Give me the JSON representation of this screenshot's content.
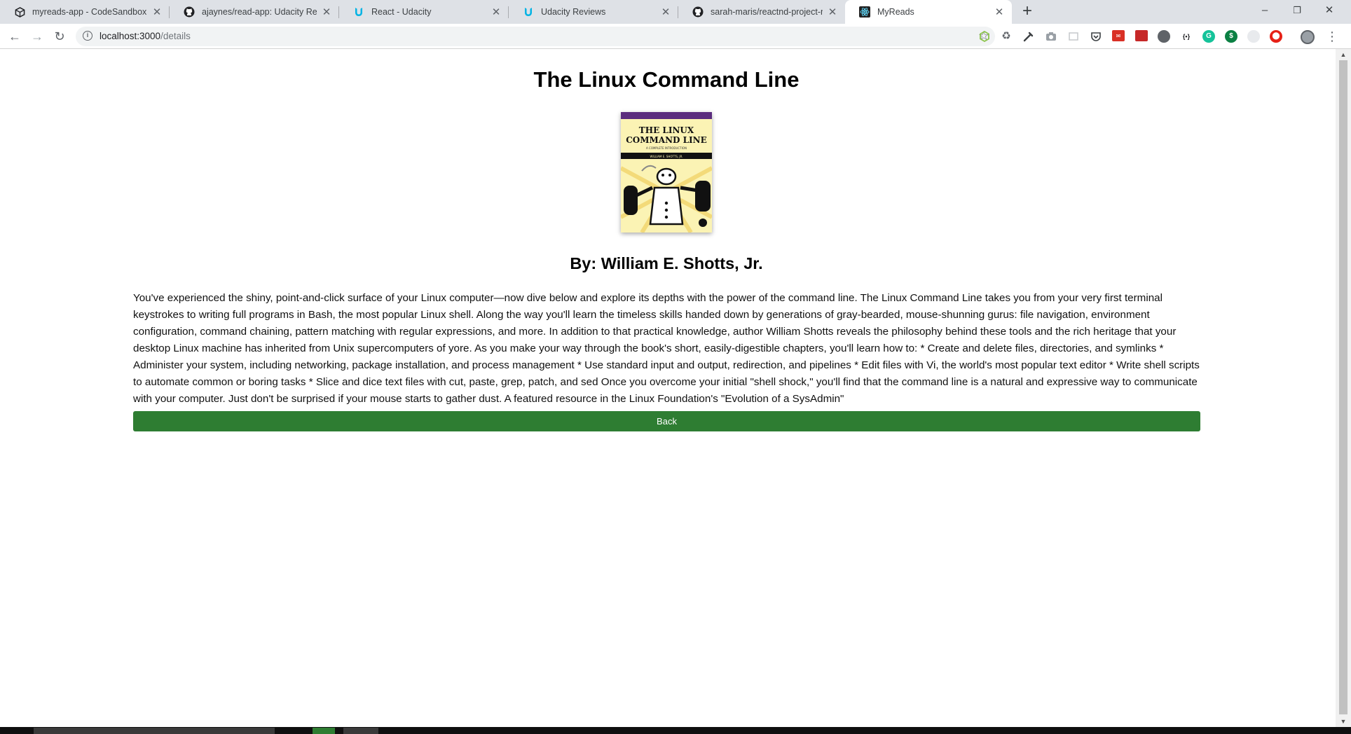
{
  "browser": {
    "tabs": [
      {
        "title": "myreads-app - CodeSandbox",
        "icon": "codesandbox-icon",
        "active": false
      },
      {
        "title": "ajaynes/read-app: Udacity Read",
        "icon": "github-icon",
        "active": false
      },
      {
        "title": "React - Udacity",
        "icon": "udacity-icon",
        "active": false
      },
      {
        "title": "Udacity Reviews",
        "icon": "udacity-icon",
        "active": false
      },
      {
        "title": "sarah-maris/reactnd-project-my",
        "icon": "github-icon",
        "active": false
      },
      {
        "title": "MyReads",
        "icon": "react-icon",
        "active": true
      }
    ],
    "new_tab_symbol": "+",
    "window_controls": {
      "minimize": "–",
      "restore": "❐",
      "close": "✕"
    },
    "address": {
      "host": "localhost:3000",
      "path": "/details"
    },
    "colors": {
      "tabstrip_bg": "#dee1e6",
      "omnibox_bg": "#f1f3f4"
    }
  },
  "page": {
    "title": "The Linux Command Line",
    "cover": {
      "title_line1": "THE LINUX",
      "title_line2": "COMMAND LINE",
      "subtitle": "A COMPLETE INTRODUCTION",
      "author_small": "WILLIAM E. SHOTTS, JR."
    },
    "author": "By: William E. Shotts, Jr.",
    "description": "You've experienced the shiny, point-and-click surface of your Linux computer—now dive below and explore its depths with the power of the command line. The Linux Command Line takes you from your very first terminal keystrokes to writing full programs in Bash, the most popular Linux shell. Along the way you'll learn the timeless skills handed down by generations of gray-bearded, mouse-shunning gurus: file navigation, environment configuration, command chaining, pattern matching with regular expressions, and more. In addition to that practical knowledge, author William Shotts reveals the philosophy behind these tools and the rich heritage that your desktop Linux machine has inherited from Unix supercomputers of yore. As you make your way through the book's short, easily-digestible chapters, you'll learn how to: * Create and delete files, directories, and symlinks * Administer your system, including networking, package installation, and process management * Use standard input and output, redirection, and pipelines * Edit files with Vi, the world's most popular text editor * Write shell scripts to automate common or boring tasks * Slice and dice text files with cut, paste, grep, patch, and sed Once you overcome your initial \"shell shock,\" you'll find that the command line is a natural and expressive way to communicate with your computer. Just don't be surprised if your mouse starts to gather dust. A featured resource in the Linux Foundation's \"Evolution of a SysAdmin\"",
    "back_label": "Back",
    "colors": {
      "button": "#2e7d32",
      "cover_band": "#5b2c7e",
      "cover_bg": "#fbf3b4"
    }
  }
}
